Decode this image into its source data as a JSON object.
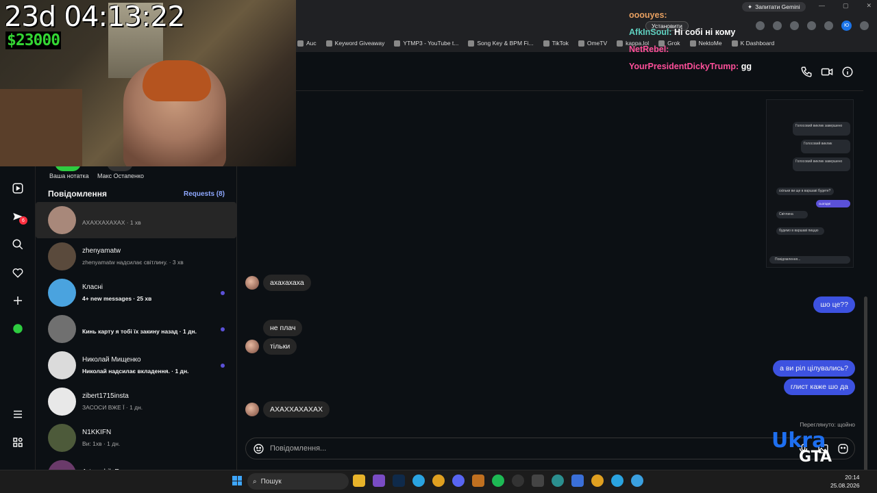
{
  "browser": {
    "gemini_label": "Запитати Gemini",
    "install_label": "Установити",
    "profile_initials": "Ю",
    "bookmarks": [
      "Auc",
      "Keyword Giveaway",
      "YTMP3 - YouTube t...",
      "Song Key & BPM Fi...",
      "TikTok",
      "OmeTV",
      "kappa.lol",
      "Grok",
      "NektoMe",
      "K Dashboard"
    ]
  },
  "stream": {
    "timer": "23d 04:13:22",
    "money": "$23000",
    "chat": [
      {
        "user": "ooouyes:",
        "user_color": "#e8a060",
        "message": ""
      },
      {
        "user": "AfkInSoul:",
        "user_color": "#5fd0c0",
        "message": "Ні собі ні кому"
      },
      {
        "user": "NetRebel:",
        "user_color": "#ff4f9a",
        "message": ""
      },
      {
        "user": "YourPresidentDickyTrump:",
        "user_color": "#ff4f9a",
        "message": "gg"
      }
    ],
    "logo_top": "Ukra",
    "logo_bottom": "GTA"
  },
  "inbox": {
    "notes": [
      "Ваша нотатка",
      "Макс Остапенко"
    ],
    "title": "Повідомлення",
    "requests": "Requests (8)",
    "rail_badge": "6",
    "threads": [
      {
        "name": "",
        "preview": "АХАХХАХАХАХ · 1 хв",
        "unread": false,
        "active": true,
        "avatar_color": "#a8887a"
      },
      {
        "name": "zhenyamatw",
        "preview": "zhenyamatw надсилає світлину. · 3 хв",
        "unread": false,
        "active": false,
        "avatar_color": "#5a4a3c"
      },
      {
        "name": "Класні",
        "preview": "4+ new messages · 25 хв",
        "unread": true,
        "active": false,
        "avatar_color": "#4aa3df"
      },
      {
        "name": "",
        "preview": "Кинь карту я тобі їх закину назад · 1 дн.",
        "unread": true,
        "active": false,
        "avatar_color": "#707070"
      },
      {
        "name": "Николай Мищенко",
        "preview": "Николай надсилає вкладення. · 1 дн.",
        "unread": true,
        "active": false,
        "avatar_color": "#dbdbdb"
      },
      {
        "name": "zibert1715insta",
        "preview": "ЗАСОСИ ВЖЕ Ї · 1 дн.",
        "unread": false,
        "active": false,
        "avatar_color": "#e8e8e8"
      },
      {
        "name": "N1KKIFN",
        "preview": "Ви: 1хв · 1 дн.",
        "unread": false,
        "active": false,
        "avatar_color": "#4d5a3a"
      },
      {
        "name": "Artemchik Revo",
        "preview": "",
        "unread": false,
        "active": false,
        "avatar_color": "#6a3a6a"
      }
    ]
  },
  "chat": {
    "messages": [
      {
        "text": "ахахахаха",
        "direction": "in",
        "avatar": true
      },
      {
        "text": "шо це??",
        "direction": "out"
      },
      {
        "text": "не плач",
        "direction": "in",
        "avatar": false
      },
      {
        "text": "тільки",
        "direction": "in",
        "avatar": true
      },
      {
        "text": "а ви ріл цілувались?",
        "direction": "out"
      },
      {
        "text": "глист каже шо да",
        "direction": "out"
      },
      {
        "text": "АХАХХАХАХАХ",
        "direction": "in",
        "avatar": true
      }
    ],
    "seen": "Переглянуто: щойно",
    "composer_placeholder": "Повідомлення..."
  },
  "embedded_screenshot": {
    "items": [
      "Голосовий виклик завершено",
      "Голосовий виклик",
      "Голосовий виклик завершено",
      "скільки ви ще в варшаві будете?",
      "сьогоднi",
      "Світлина",
      "будемо в варшаві пиццю",
      "Повідомлення..."
    ]
  },
  "taskbar": {
    "search_label": "Пошук",
    "time": "20:14",
    "date": "25.08.2026"
  },
  "colors": {
    "accent": "#3d52e0",
    "background": "#0c1014",
    "bubble_in": "#262626"
  }
}
